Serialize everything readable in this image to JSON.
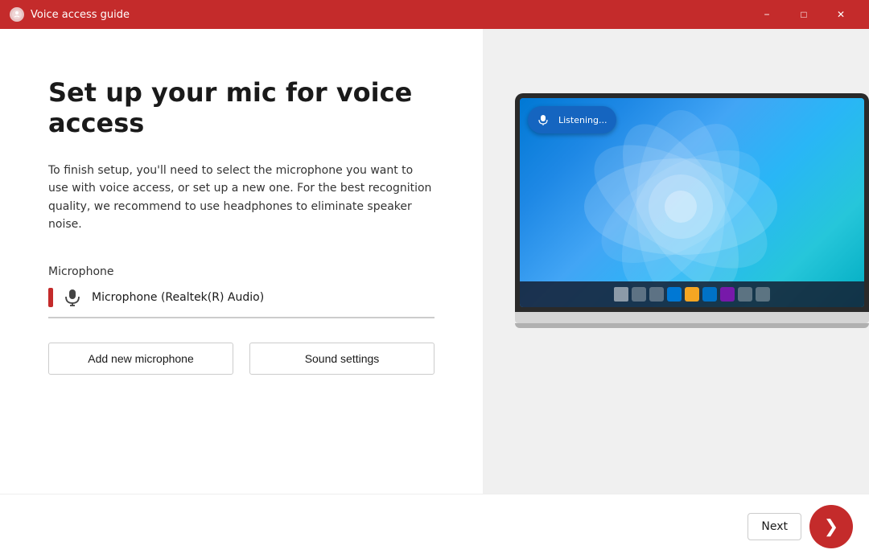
{
  "titleBar": {
    "title": "Voice access guide",
    "minimize": "−",
    "maximize": "□",
    "close": "✕"
  },
  "leftPanel": {
    "heading": "Set up your mic for voice access",
    "description": "To finish setup, you'll need to select the microphone you want to use with voice access, or set up a new one. For the best recognition quality, we recommend to use headphones to eliminate speaker noise.",
    "microphoneLabel": "Microphone",
    "microphoneValue": "Microphone (Realtek(R) Audio)",
    "addMicButton": "Add new microphone",
    "soundSettingsButton": "Sound settings"
  },
  "rightPanel": {
    "listeningText": "Listening...",
    "taskbarIcons": [
      "start",
      "search",
      "taskview",
      "edge",
      "files",
      "mail",
      "store",
      "settings",
      "clock"
    ]
  },
  "bottomBar": {
    "nextLabel": "Next",
    "nextArrow": "❯"
  },
  "colors": {
    "accent": "#c42b2b",
    "titleBarBg": "#c42b2b",
    "listeningBarBg": "#1565c0"
  }
}
